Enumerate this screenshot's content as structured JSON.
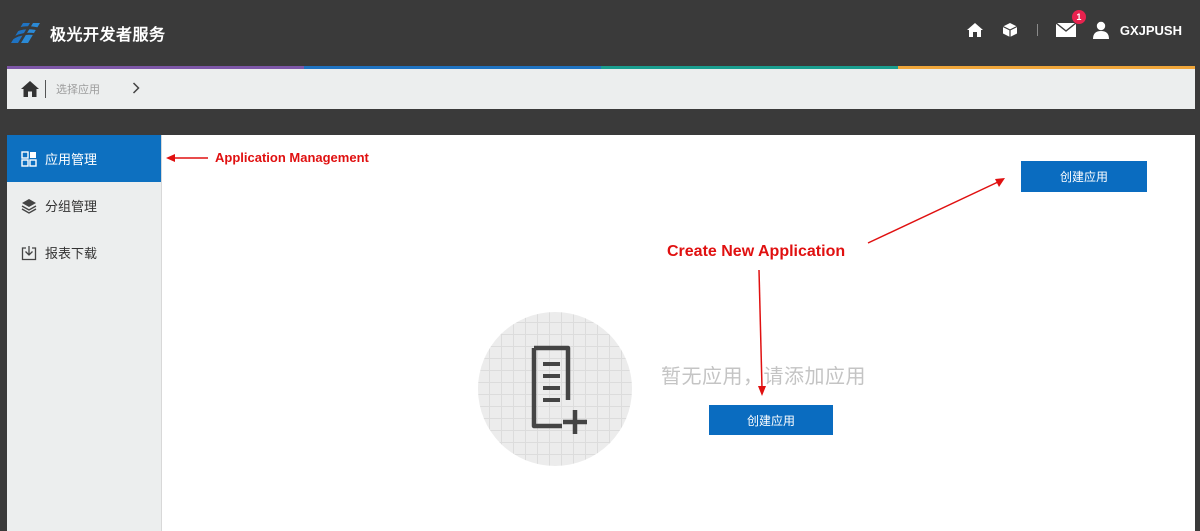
{
  "header": {
    "brand_name": "极光开发者服务",
    "notification_count": "1",
    "username": "GXJPUSH",
    "icons": [
      "home-icon",
      "cube-icon",
      "mail-icon",
      "user-icon"
    ]
  },
  "strip_colors": [
    "#7e57a8",
    "#1f73c2",
    "#1a9e8f",
    "#f0a63a"
  ],
  "breadcrumb": {
    "current": "选择应用"
  },
  "sidebar": {
    "items": [
      {
        "label": "应用管理",
        "icon": "grid-icon",
        "active": true
      },
      {
        "label": "分组管理",
        "icon": "layers-icon",
        "active": false
      },
      {
        "label": "报表下载",
        "icon": "download-icon",
        "active": false
      }
    ]
  },
  "main": {
    "create_button_top": "创建应用",
    "empty_message": "暂无应用，请添加应用",
    "create_button_center": "创建应用"
  },
  "annotations": {
    "app_management": "Application Management",
    "create_new": "Create New Application"
  },
  "colors": {
    "primary": "#0a6cc0",
    "topbar": "#3a3a3a",
    "annotation": "#e01010",
    "badge": "#e8224e"
  }
}
